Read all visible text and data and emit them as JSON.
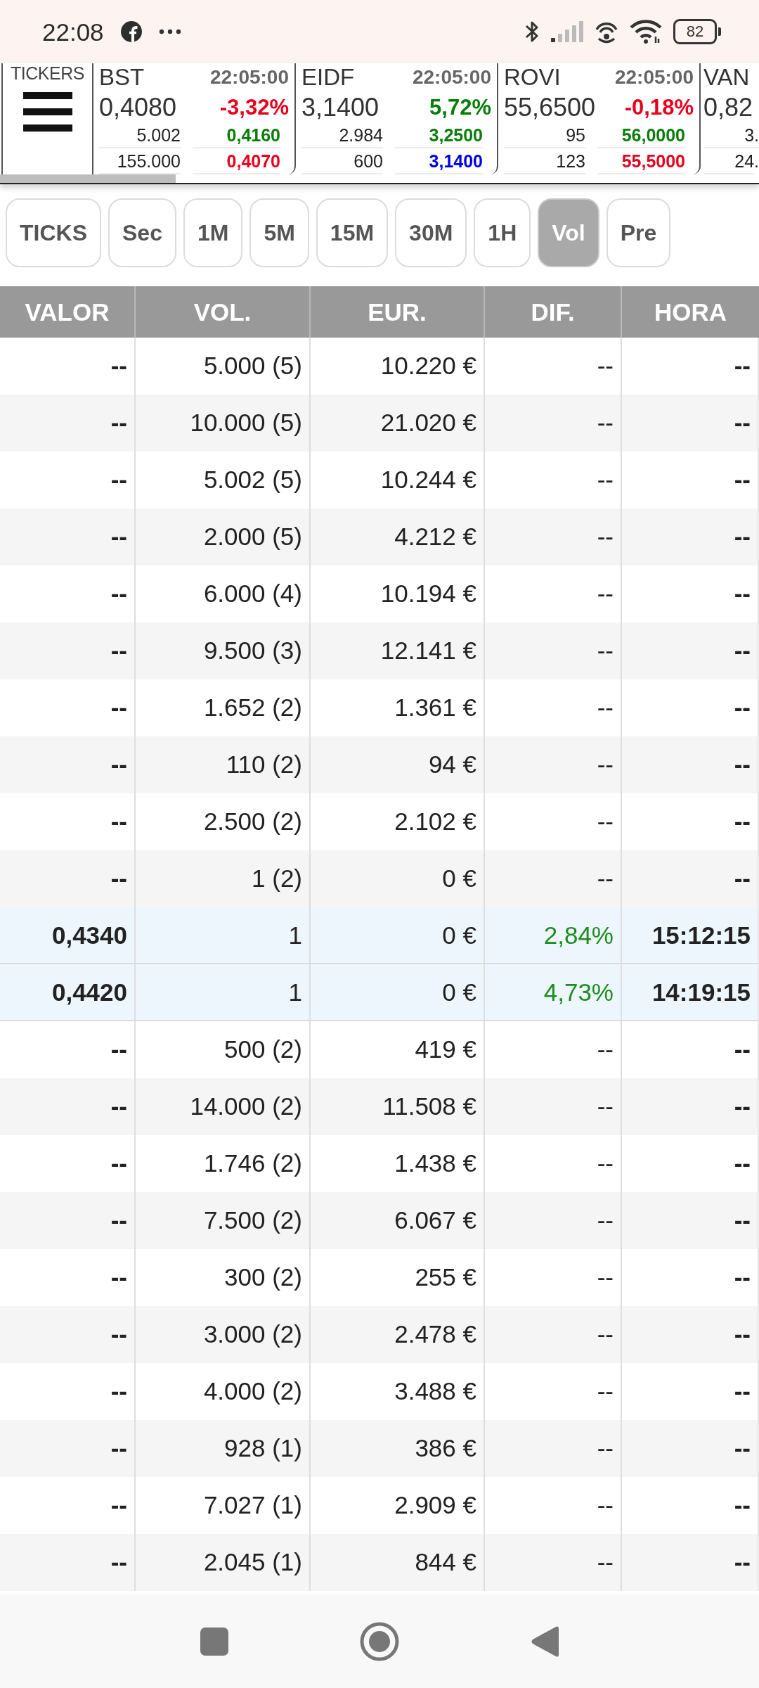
{
  "status_bar": {
    "time": "22:08",
    "battery": "82"
  },
  "tickers_panel": {
    "label": "TICKERS"
  },
  "tickers": [
    {
      "symbol": "BST",
      "time": "22:05:00",
      "price": "0,4080",
      "change": {
        "text": "-3,32%",
        "color": "#e8001d"
      },
      "rows": [
        {
          "volume": "5.002",
          "quote": {
            "text": "0,4160",
            "color": "#087d08"
          }
        },
        {
          "volume": "155.000",
          "quote": {
            "text": "0,4070",
            "color": "#e8001d"
          }
        }
      ]
    },
    {
      "symbol": "EIDF",
      "time": "22:05:00",
      "price": "3,1400",
      "change": {
        "text": "5,72%",
        "color": "#087d08"
      },
      "rows": [
        {
          "volume": "2.984",
          "quote": {
            "text": "3,2500",
            "color": "#087d08"
          }
        },
        {
          "volume": "600",
          "quote": {
            "text": "3,1400",
            "color": "#0000e6"
          }
        }
      ]
    },
    {
      "symbol": "ROVI",
      "time": "22:05:00",
      "price": "55,6500",
      "change": {
        "text": "-0,18%",
        "color": "#e8001d"
      },
      "rows": [
        {
          "volume": "95",
          "quote": {
            "text": "56,0000",
            "color": "#087d08"
          }
        },
        {
          "volume": "123",
          "quote": {
            "text": "55,5000",
            "color": "#e8001d"
          }
        }
      ]
    },
    {
      "symbol": "VAN",
      "price": "0,82",
      "rows": [
        {
          "volume": "3."
        },
        {
          "volume": "24."
        }
      ]
    }
  ],
  "intervals": [
    {
      "label": "TICKS",
      "selected": false
    },
    {
      "label": "Sec",
      "selected": false
    },
    {
      "label": "1M",
      "selected": false
    },
    {
      "label": "5M",
      "selected": false
    },
    {
      "label": "15M",
      "selected": false
    },
    {
      "label": "30M",
      "selected": false
    },
    {
      "label": "1H",
      "selected": false
    },
    {
      "label": "Vol",
      "selected": true
    },
    {
      "label": "Pre",
      "selected": false
    }
  ],
  "table": {
    "columns": [
      "VALOR",
      "VOL.",
      "EUR.",
      "DIF.",
      "HORA"
    ],
    "rows": [
      {
        "valor": "--",
        "vol": "5.000 (5)",
        "eur": "10.220 €",
        "dif": {
          "text": "--"
        },
        "hora": "--",
        "highlighted": false
      },
      {
        "valor": "--",
        "vol": "10.000 (5)",
        "eur": "21.020 €",
        "dif": {
          "text": "--"
        },
        "hora": "--",
        "highlighted": false
      },
      {
        "valor": "--",
        "vol": "5.002 (5)",
        "eur": "10.244 €",
        "dif": {
          "text": "--"
        },
        "hora": "--",
        "highlighted": false
      },
      {
        "valor": "--",
        "vol": "2.000 (5)",
        "eur": "4.212 €",
        "dif": {
          "text": "--"
        },
        "hora": "--",
        "highlighted": false
      },
      {
        "valor": "--",
        "vol": "6.000 (4)",
        "eur": "10.194 €",
        "dif": {
          "text": "--"
        },
        "hora": "--",
        "highlighted": false
      },
      {
        "valor": "--",
        "vol": "9.500 (3)",
        "eur": "12.141 €",
        "dif": {
          "text": "--"
        },
        "hora": "--",
        "highlighted": false
      },
      {
        "valor": "--",
        "vol": "1.652 (2)",
        "eur": "1.361 €",
        "dif": {
          "text": "--"
        },
        "hora": "--",
        "highlighted": false
      },
      {
        "valor": "--",
        "vol": "110 (2)",
        "eur": "94 €",
        "dif": {
          "text": "--"
        },
        "hora": "--",
        "highlighted": false
      },
      {
        "valor": "--",
        "vol": "2.500 (2)",
        "eur": "2.102 €",
        "dif": {
          "text": "--"
        },
        "hora": "--",
        "highlighted": false
      },
      {
        "valor": "--",
        "vol": "1 (2)",
        "eur": "0 €",
        "dif": {
          "text": "--"
        },
        "hora": "--",
        "highlighted": false
      },
      {
        "valor": "0,4340",
        "vol": "1",
        "eur": "0 €",
        "dif": {
          "text": "2,84%",
          "color": "#1e8c1e"
        },
        "hora": "15:12:15",
        "highlighted": true
      },
      {
        "valor": "0,4420",
        "vol": "1",
        "eur": "0 €",
        "dif": {
          "text": "4,73%",
          "color": "#1e8c1e"
        },
        "hora": "14:19:15",
        "highlighted": true
      },
      {
        "valor": "--",
        "vol": "500 (2)",
        "eur": "419 €",
        "dif": {
          "text": "--"
        },
        "hora": "--",
        "highlighted": false
      },
      {
        "valor": "--",
        "vol": "14.000 (2)",
        "eur": "11.508 €",
        "dif": {
          "text": "--"
        },
        "hora": "--",
        "highlighted": false
      },
      {
        "valor": "--",
        "vol": "1.746 (2)",
        "eur": "1.438 €",
        "dif": {
          "text": "--"
        },
        "hora": "--",
        "highlighted": false
      },
      {
        "valor": "--",
        "vol": "7.500 (2)",
        "eur": "6.067 €",
        "dif": {
          "text": "--"
        },
        "hora": "--",
        "highlighted": false
      },
      {
        "valor": "--",
        "vol": "300 (2)",
        "eur": "255 €",
        "dif": {
          "text": "--"
        },
        "hora": "--",
        "highlighted": false
      },
      {
        "valor": "--",
        "vol": "3.000 (2)",
        "eur": "2.478 €",
        "dif": {
          "text": "--"
        },
        "hora": "--",
        "highlighted": false
      },
      {
        "valor": "--",
        "vol": "4.000 (2)",
        "eur": "3.488 €",
        "dif": {
          "text": "--"
        },
        "hora": "--",
        "highlighted": false
      },
      {
        "valor": "--",
        "vol": "928 (1)",
        "eur": "386 €",
        "dif": {
          "text": "--"
        },
        "hora": "--",
        "highlighted": false
      },
      {
        "valor": "--",
        "vol": "7.027 (1)",
        "eur": "2.909 €",
        "dif": {
          "text": "--"
        },
        "hora": "--",
        "highlighted": false
      },
      {
        "valor": "--",
        "vol": "2.045 (1)",
        "eur": "844 €",
        "dif": {
          "text": "--"
        },
        "hora": "--",
        "highlighted": false
      }
    ]
  }
}
